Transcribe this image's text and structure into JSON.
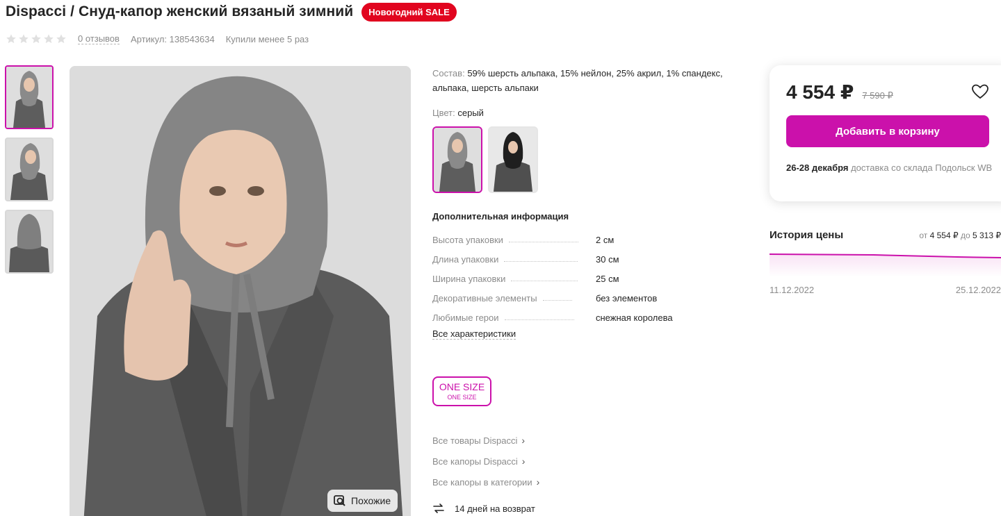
{
  "product": {
    "title": "Dispacci / Снуд-капор женский вязаный зимний",
    "sale_badge": "Новогодний SALE",
    "rating_stars": 0,
    "reviews": "0 отзывов",
    "article_label": "Артикул:",
    "article": "138543634",
    "bought": "Купили менее 5 раз"
  },
  "gallery": {
    "thumbs": [
      {
        "name": "thumb-1",
        "active": true
      },
      {
        "name": "thumb-2",
        "active": false
      },
      {
        "name": "thumb-3",
        "active": false
      }
    ],
    "similar_button": "Похожие"
  },
  "details": {
    "composition_label": "Состав:",
    "composition": "59% шерсть альпака, 15% нейлон, 25% акрил, 1% спандекс, альпака, шерсть альпаки",
    "color_label": "Цвет:",
    "color_value": "серый",
    "additional_title": "Дополнительная информация",
    "characteristics": [
      {
        "name": "Высота упаковки",
        "value": "2 см"
      },
      {
        "name": "Длина упаковки",
        "value": "30 см"
      },
      {
        "name": "Ширина упаковки",
        "value": "25 см"
      },
      {
        "name": "Декоративные элементы",
        "value": "без элементов"
      },
      {
        "name": "Любимые герои",
        "value": "снежная королева"
      }
    ],
    "all_characteristics": "Все характеристики",
    "size_main": "ONE SIZE",
    "size_sub": "ONE SIZE",
    "links": [
      "Все товары Dispacci",
      "Все капоры Dispacci",
      "Все капоры в категории"
    ],
    "return_text": "14 дней на возврат"
  },
  "price_card": {
    "price": "4 554 ₽",
    "old_price": "7 590 ₽",
    "add_to_cart": "Добавить в корзину",
    "delivery_date": "26-28 декабря",
    "delivery_text": "доставка со склада Подольск WB"
  },
  "price_history": {
    "title": "История цены",
    "range_from_label": "от",
    "range_from": "4 554 ₽",
    "range_to_label": "до",
    "range_to": "5 313 ₽",
    "date_start": "11.12.2022",
    "date_end": "25.12.2022"
  },
  "colors": {
    "accent": "#cb11ab",
    "sale": "#e1051f",
    "text": "#242424",
    "muted": "#8b8b8b"
  }
}
